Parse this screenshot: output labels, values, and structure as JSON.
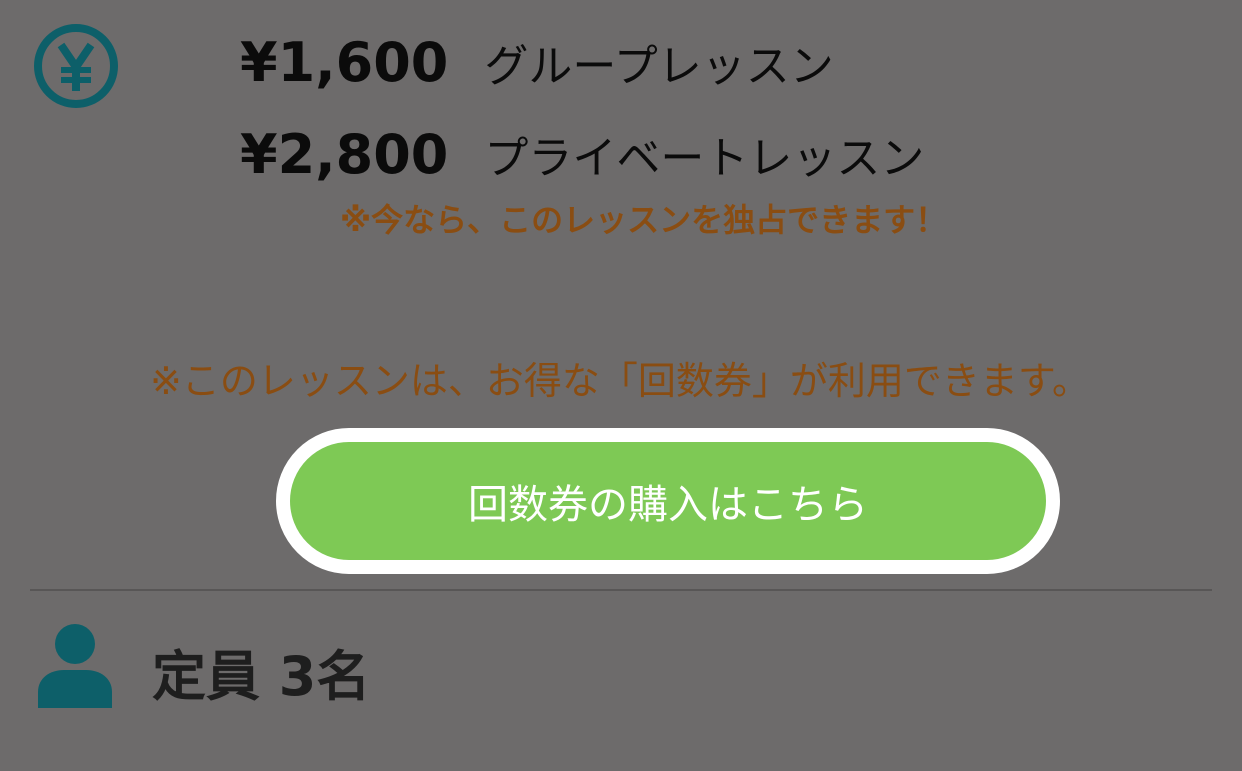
{
  "pricing": {
    "icon": "yen-circle-icon",
    "rows": [
      {
        "amount": "¥1,600",
        "label": "グループレッスン"
      },
      {
        "amount": "¥2,800",
        "label": "プライベートレッスン"
      }
    ],
    "exclusive_note": "※今なら、このレッスンを独占できます！"
  },
  "ticket": {
    "note": "※このレッスンは、お得な「回数券」が利用できます。",
    "button_label": "回数券の購入はこちら"
  },
  "capacity": {
    "icon": "person-icon",
    "text": "定員 3名"
  },
  "colors": {
    "background": "#6d6b6b",
    "icon_teal": "#0d5f69",
    "note_orange": "#8a4d12",
    "button_green": "#7ec955",
    "button_border": "#ffffff"
  }
}
